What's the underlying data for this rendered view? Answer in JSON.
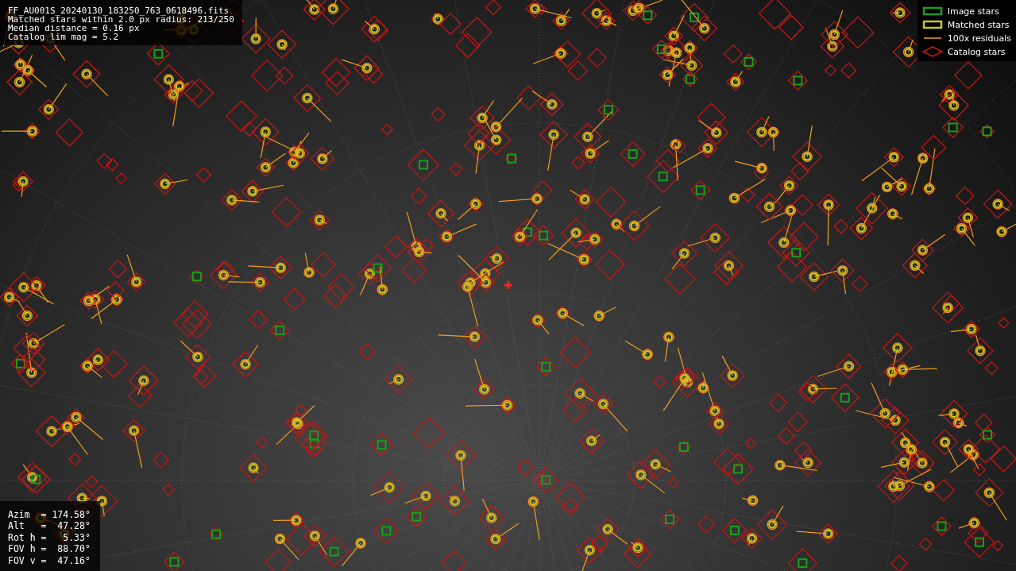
{
  "info": {
    "lines": [
      "FF_AU001S_20240130_183250_763_0618496.fits",
      "Matched stars within 2.0 px radius: 213/250",
      "Median distance = 0.16 px",
      "Catalog lim mag = 5.2"
    ]
  },
  "legend": [
    {
      "kind": "image",
      "label": "Image stars"
    },
    {
      "kind": "matched",
      "label": "Matched stars"
    },
    {
      "kind": "residual",
      "label": "100x residuals"
    },
    {
      "kind": "catalog",
      "label": "Catalog stars"
    }
  ],
  "pointing": {
    "lines": [
      "Azim  = 174.58°",
      "Alt   =  47.28°",
      "Rot h =   5.33°",
      "FOV h =  88.70°",
      "FOV v =  47.16°"
    ]
  }
}
